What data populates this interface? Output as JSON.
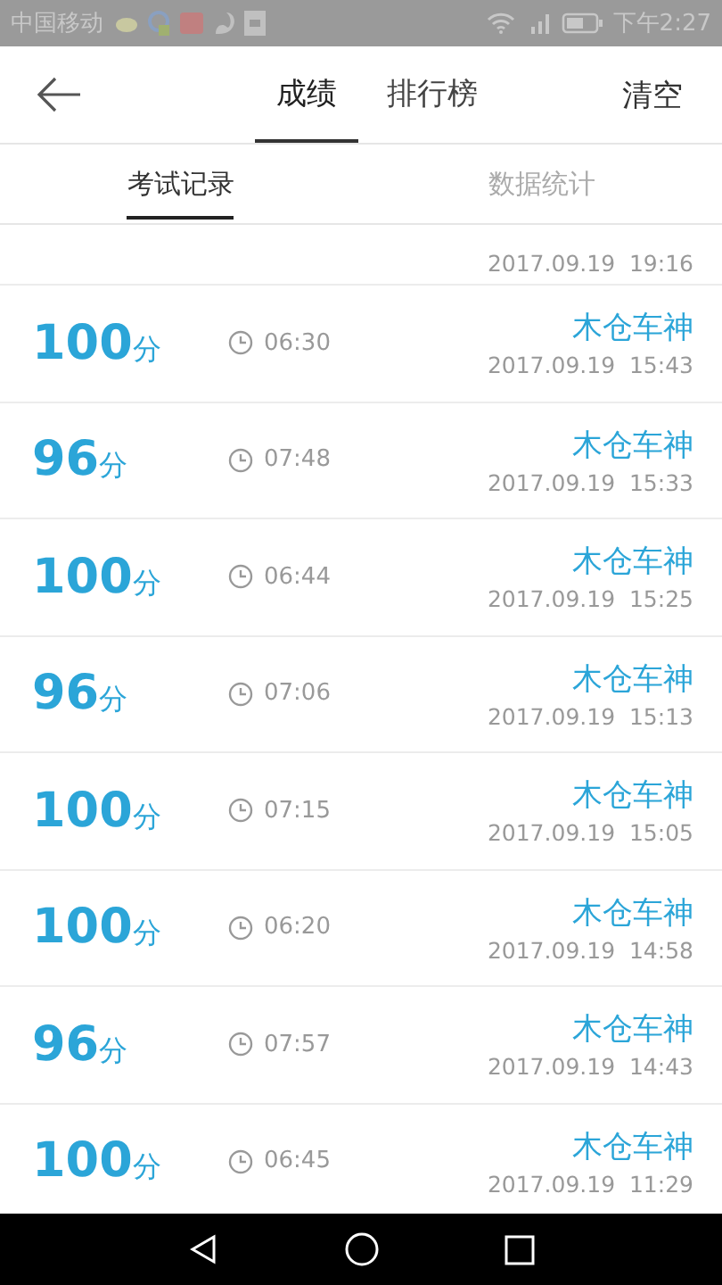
{
  "status_bar": {
    "carrier": "中国移动",
    "time": "下午2:27"
  },
  "header": {
    "tabs": [
      {
        "label": "成绩",
        "selected": true
      },
      {
        "label": "排行榜",
        "selected": false
      }
    ],
    "action": "清空"
  },
  "sub_tabs": [
    {
      "label": "考试记录",
      "selected": true
    },
    {
      "label": "数据统计",
      "selected": false
    }
  ],
  "partial_record": {
    "date": "2017.09.19  19:16"
  },
  "records": [
    {
      "score": "100",
      "unit": "分",
      "duration": "06:30",
      "name": "木仓车神",
      "date": "2017.09.19  15:43"
    },
    {
      "score": "96",
      "unit": "分",
      "duration": "07:48",
      "name": "木仓车神",
      "date": "2017.09.19  15:33"
    },
    {
      "score": "100",
      "unit": "分",
      "duration": "06:44",
      "name": "木仓车神",
      "date": "2017.09.19  15:25"
    },
    {
      "score": "96",
      "unit": "分",
      "duration": "07:06",
      "name": "木仓车神",
      "date": "2017.09.19  15:13"
    },
    {
      "score": "100",
      "unit": "分",
      "duration": "07:15",
      "name": "木仓车神",
      "date": "2017.09.19  15:05"
    },
    {
      "score": "100",
      "unit": "分",
      "duration": "06:20",
      "name": "木仓车神",
      "date": "2017.09.19  14:58"
    },
    {
      "score": "96",
      "unit": "分",
      "duration": "07:57",
      "name": "木仓车神",
      "date": "2017.09.19  14:43"
    },
    {
      "score": "100",
      "unit": "分",
      "duration": "06:45",
      "name": "木仓车神",
      "date": "2017.09.19  11:29"
    }
  ]
}
